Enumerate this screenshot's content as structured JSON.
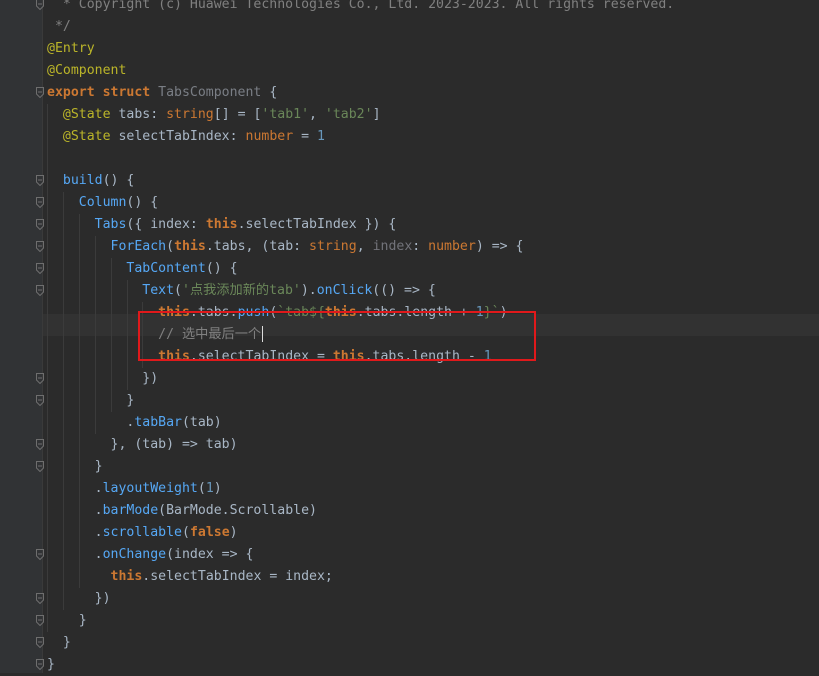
{
  "colors": {
    "background": "#2b2b2b",
    "gutter": "#313335",
    "highlight_box": "#e0191b",
    "keyword": "#cc7832",
    "annotation": "#bbb529",
    "string": "#6a8759",
    "number": "#6897bb",
    "function": "#56a8f5",
    "comment": "#808080"
  },
  "lines": [
    {
      "tokens": [
        {
          "t": "  * Copyright (c) Huawei Technologies Co., Ltd. 2023-2023. All rights reserved.",
          "k": "comment"
        }
      ]
    },
    {
      "tokens": [
        {
          "t": " */",
          "k": "comment"
        }
      ]
    },
    {
      "tokens": [
        {
          "t": "@Entry",
          "k": "ann"
        }
      ]
    },
    {
      "tokens": [
        {
          "t": "@Component",
          "k": "ann"
        }
      ]
    },
    {
      "tokens": [
        {
          "t": "export struct ",
          "k": "kw"
        },
        {
          "t": "TabsComponent",
          "k": "struct"
        },
        {
          "t": " {",
          "k": "punct"
        }
      ]
    },
    {
      "tokens": [
        {
          "t": "  ",
          "k": "punct"
        },
        {
          "t": "@State",
          "k": "ann"
        },
        {
          "t": " tabs: ",
          "k": "punct"
        },
        {
          "t": "string",
          "k": "type"
        },
        {
          "t": "[] = [",
          "k": "punct"
        },
        {
          "t": "'tab1'",
          "k": "str"
        },
        {
          "t": ", ",
          "k": "punct"
        },
        {
          "t": "'tab2'",
          "k": "str"
        },
        {
          "t": "]",
          "k": "punct"
        }
      ]
    },
    {
      "tokens": [
        {
          "t": "  ",
          "k": "punct"
        },
        {
          "t": "@State",
          "k": "ann"
        },
        {
          "t": " selectTabIndex: ",
          "k": "punct"
        },
        {
          "t": "number",
          "k": "type"
        },
        {
          "t": " = ",
          "k": "punct"
        },
        {
          "t": "1",
          "k": "num"
        }
      ]
    },
    {
      "tokens": []
    },
    {
      "tokens": [
        {
          "t": "  ",
          "k": "punct"
        },
        {
          "t": "build",
          "k": "fn"
        },
        {
          "t": "() {",
          "k": "punct"
        }
      ]
    },
    {
      "tokens": [
        {
          "t": "    ",
          "k": "punct"
        },
        {
          "t": "Column",
          "k": "comp"
        },
        {
          "t": "() {",
          "k": "punct"
        }
      ]
    },
    {
      "tokens": [
        {
          "t": "      ",
          "k": "punct"
        },
        {
          "t": "Tabs",
          "k": "comp"
        },
        {
          "t": "({ index: ",
          "k": "punct"
        },
        {
          "t": "this",
          "k": "kw"
        },
        {
          "t": ".selectTabIndex }) {",
          "k": "punct"
        }
      ]
    },
    {
      "tokens": [
        {
          "t": "        ",
          "k": "punct"
        },
        {
          "t": "ForEach",
          "k": "comp"
        },
        {
          "t": "(",
          "k": "punct"
        },
        {
          "t": "this",
          "k": "kw"
        },
        {
          "t": ".tabs, (tab: ",
          "k": "punct"
        },
        {
          "t": "string",
          "k": "type"
        },
        {
          "t": ", ",
          "k": "punct"
        },
        {
          "t": "index",
          "k": "param"
        },
        {
          "t": ": ",
          "k": "punct"
        },
        {
          "t": "number",
          "k": "type"
        },
        {
          "t": ") => {",
          "k": "punct"
        }
      ]
    },
    {
      "tokens": [
        {
          "t": "          ",
          "k": "punct"
        },
        {
          "t": "TabContent",
          "k": "comp"
        },
        {
          "t": "() {",
          "k": "punct"
        }
      ]
    },
    {
      "tokens": [
        {
          "t": "            ",
          "k": "punct"
        },
        {
          "t": "Text",
          "k": "comp"
        },
        {
          "t": "(",
          "k": "punct"
        },
        {
          "t": "'点我添加新的tab'",
          "k": "str"
        },
        {
          "t": ").",
          "k": "punct"
        },
        {
          "t": "onClick",
          "k": "fn"
        },
        {
          "t": "(() => {",
          "k": "punct"
        }
      ]
    },
    {
      "tokens": [
        {
          "t": "              ",
          "k": "punct"
        },
        {
          "t": "this",
          "k": "kw"
        },
        {
          "t": ".tabs.",
          "k": "punct"
        },
        {
          "t": "push",
          "k": "fn"
        },
        {
          "t": "(",
          "k": "punct"
        },
        {
          "t": "`tab${",
          "k": "str"
        },
        {
          "t": "this",
          "k": "kw"
        },
        {
          "t": ".tabs.length + ",
          "k": "punct"
        },
        {
          "t": "1",
          "k": "num"
        },
        {
          "t": "}`",
          "k": "str"
        },
        {
          "t": ")",
          "k": "punct"
        }
      ]
    },
    {
      "tokens": [
        {
          "t": "              ",
          "k": "punct"
        },
        {
          "t": "// 选中最后一个",
          "k": "comment"
        }
      ],
      "caret": true
    },
    {
      "tokens": [
        {
          "t": "              ",
          "k": "punct"
        },
        {
          "t": "this",
          "k": "kw"
        },
        {
          "t": ".selectTabIndex = ",
          "k": "punct"
        },
        {
          "t": "this",
          "k": "kw"
        },
        {
          "t": ".tabs.length - ",
          "k": "punct"
        },
        {
          "t": "1",
          "k": "num"
        }
      ]
    },
    {
      "tokens": [
        {
          "t": "            })",
          "k": "punct"
        }
      ]
    },
    {
      "tokens": [
        {
          "t": "          }",
          "k": "punct"
        }
      ]
    },
    {
      "tokens": [
        {
          "t": "          .",
          "k": "punct"
        },
        {
          "t": "tabBar",
          "k": "fn"
        },
        {
          "t": "(tab)",
          "k": "punct"
        }
      ]
    },
    {
      "tokens": [
        {
          "t": "        }, (tab) => tab)",
          "k": "punct"
        }
      ]
    },
    {
      "tokens": [
        {
          "t": "      }",
          "k": "punct"
        }
      ]
    },
    {
      "tokens": [
        {
          "t": "      .",
          "k": "punct"
        },
        {
          "t": "layoutWeight",
          "k": "fn"
        },
        {
          "t": "(",
          "k": "punct"
        },
        {
          "t": "1",
          "k": "num"
        },
        {
          "t": ")",
          "k": "punct"
        }
      ]
    },
    {
      "tokens": [
        {
          "t": "      .",
          "k": "punct"
        },
        {
          "t": "barMode",
          "k": "fn"
        },
        {
          "t": "(BarMode.Scrollable)",
          "k": "punct"
        }
      ]
    },
    {
      "tokens": [
        {
          "t": "      .",
          "k": "punct"
        },
        {
          "t": "scrollable",
          "k": "fn"
        },
        {
          "t": "(",
          "k": "punct"
        },
        {
          "t": "false",
          "k": "kw"
        },
        {
          "t": ")",
          "k": "punct"
        }
      ]
    },
    {
      "tokens": [
        {
          "t": "      .",
          "k": "punct"
        },
        {
          "t": "onChange",
          "k": "fn"
        },
        {
          "t": "(index => {",
          "k": "punct"
        }
      ]
    },
    {
      "tokens": [
        {
          "t": "        ",
          "k": "punct"
        },
        {
          "t": "this",
          "k": "kw"
        },
        {
          "t": ".selectTabIndex = index;",
          "k": "punct"
        }
      ]
    },
    {
      "tokens": [
        {
          "t": "      })",
          "k": "punct"
        }
      ]
    },
    {
      "tokens": [
        {
          "t": "    }",
          "k": "punct"
        }
      ]
    },
    {
      "tokens": [
        {
          "t": "  }",
          "k": "punct"
        }
      ]
    },
    {
      "tokens": [
        {
          "t": "}",
          "k": "punct"
        }
      ]
    }
  ]
}
